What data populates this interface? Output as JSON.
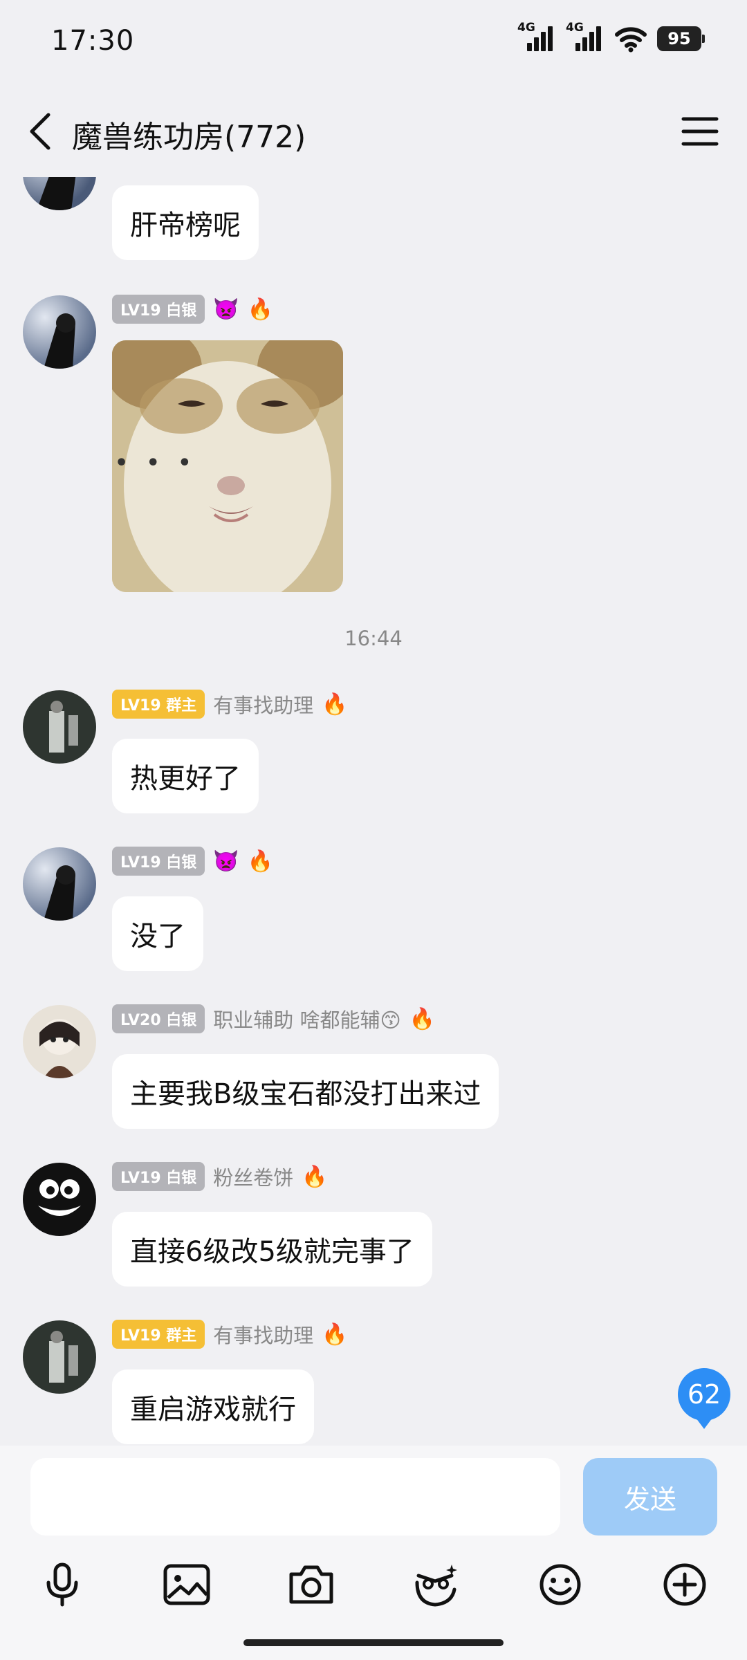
{
  "status_bar": {
    "time": "17:30",
    "network1": "4G",
    "network2": "4G",
    "battery": "95"
  },
  "header": {
    "title": "魔兽练功房(772)"
  },
  "messages": [
    {
      "text": "肝帝榜呢"
    },
    {
      "level": "LV19 白银",
      "emoji": "👿",
      "fire": "🔥",
      "sticker_caption": "• • •"
    },
    {
      "timestamp": "16:44"
    },
    {
      "level": "LV19 群主",
      "nick": "有事找助理",
      "fire": "🔥",
      "text": "热更好了"
    },
    {
      "level": "LV19 白银",
      "emoji": "👿",
      "fire": "🔥",
      "text": "没了"
    },
    {
      "level": "LV20 白银",
      "nick": "职业辅助 啥都能辅😙",
      "fire": "🔥",
      "text": "主要我B级宝石都没打出来过"
    },
    {
      "level": "LV19 白银",
      "nick": "粉丝卷饼",
      "fire": "🔥",
      "text": "直接6级改5级就完事了"
    },
    {
      "level": "LV19 群主",
      "nick": "有事找助理",
      "fire": "🔥",
      "text": "重启游戏就行"
    }
  ],
  "unread_count": "62",
  "input": {
    "placeholder": "",
    "send_label": "发送"
  },
  "toolbar_icons": [
    "microphone-icon",
    "image-icon",
    "camera-icon",
    "sticker-icon",
    "emoji-icon",
    "plus-icon"
  ],
  "colors": {
    "background": "#f0f0f3",
    "bubble": "#ffffff",
    "send_button": "#9ecbf7",
    "unread_badge": "#2d8ef5",
    "level_silver": "#b3b3b8",
    "level_owner": "#f5bf35"
  }
}
